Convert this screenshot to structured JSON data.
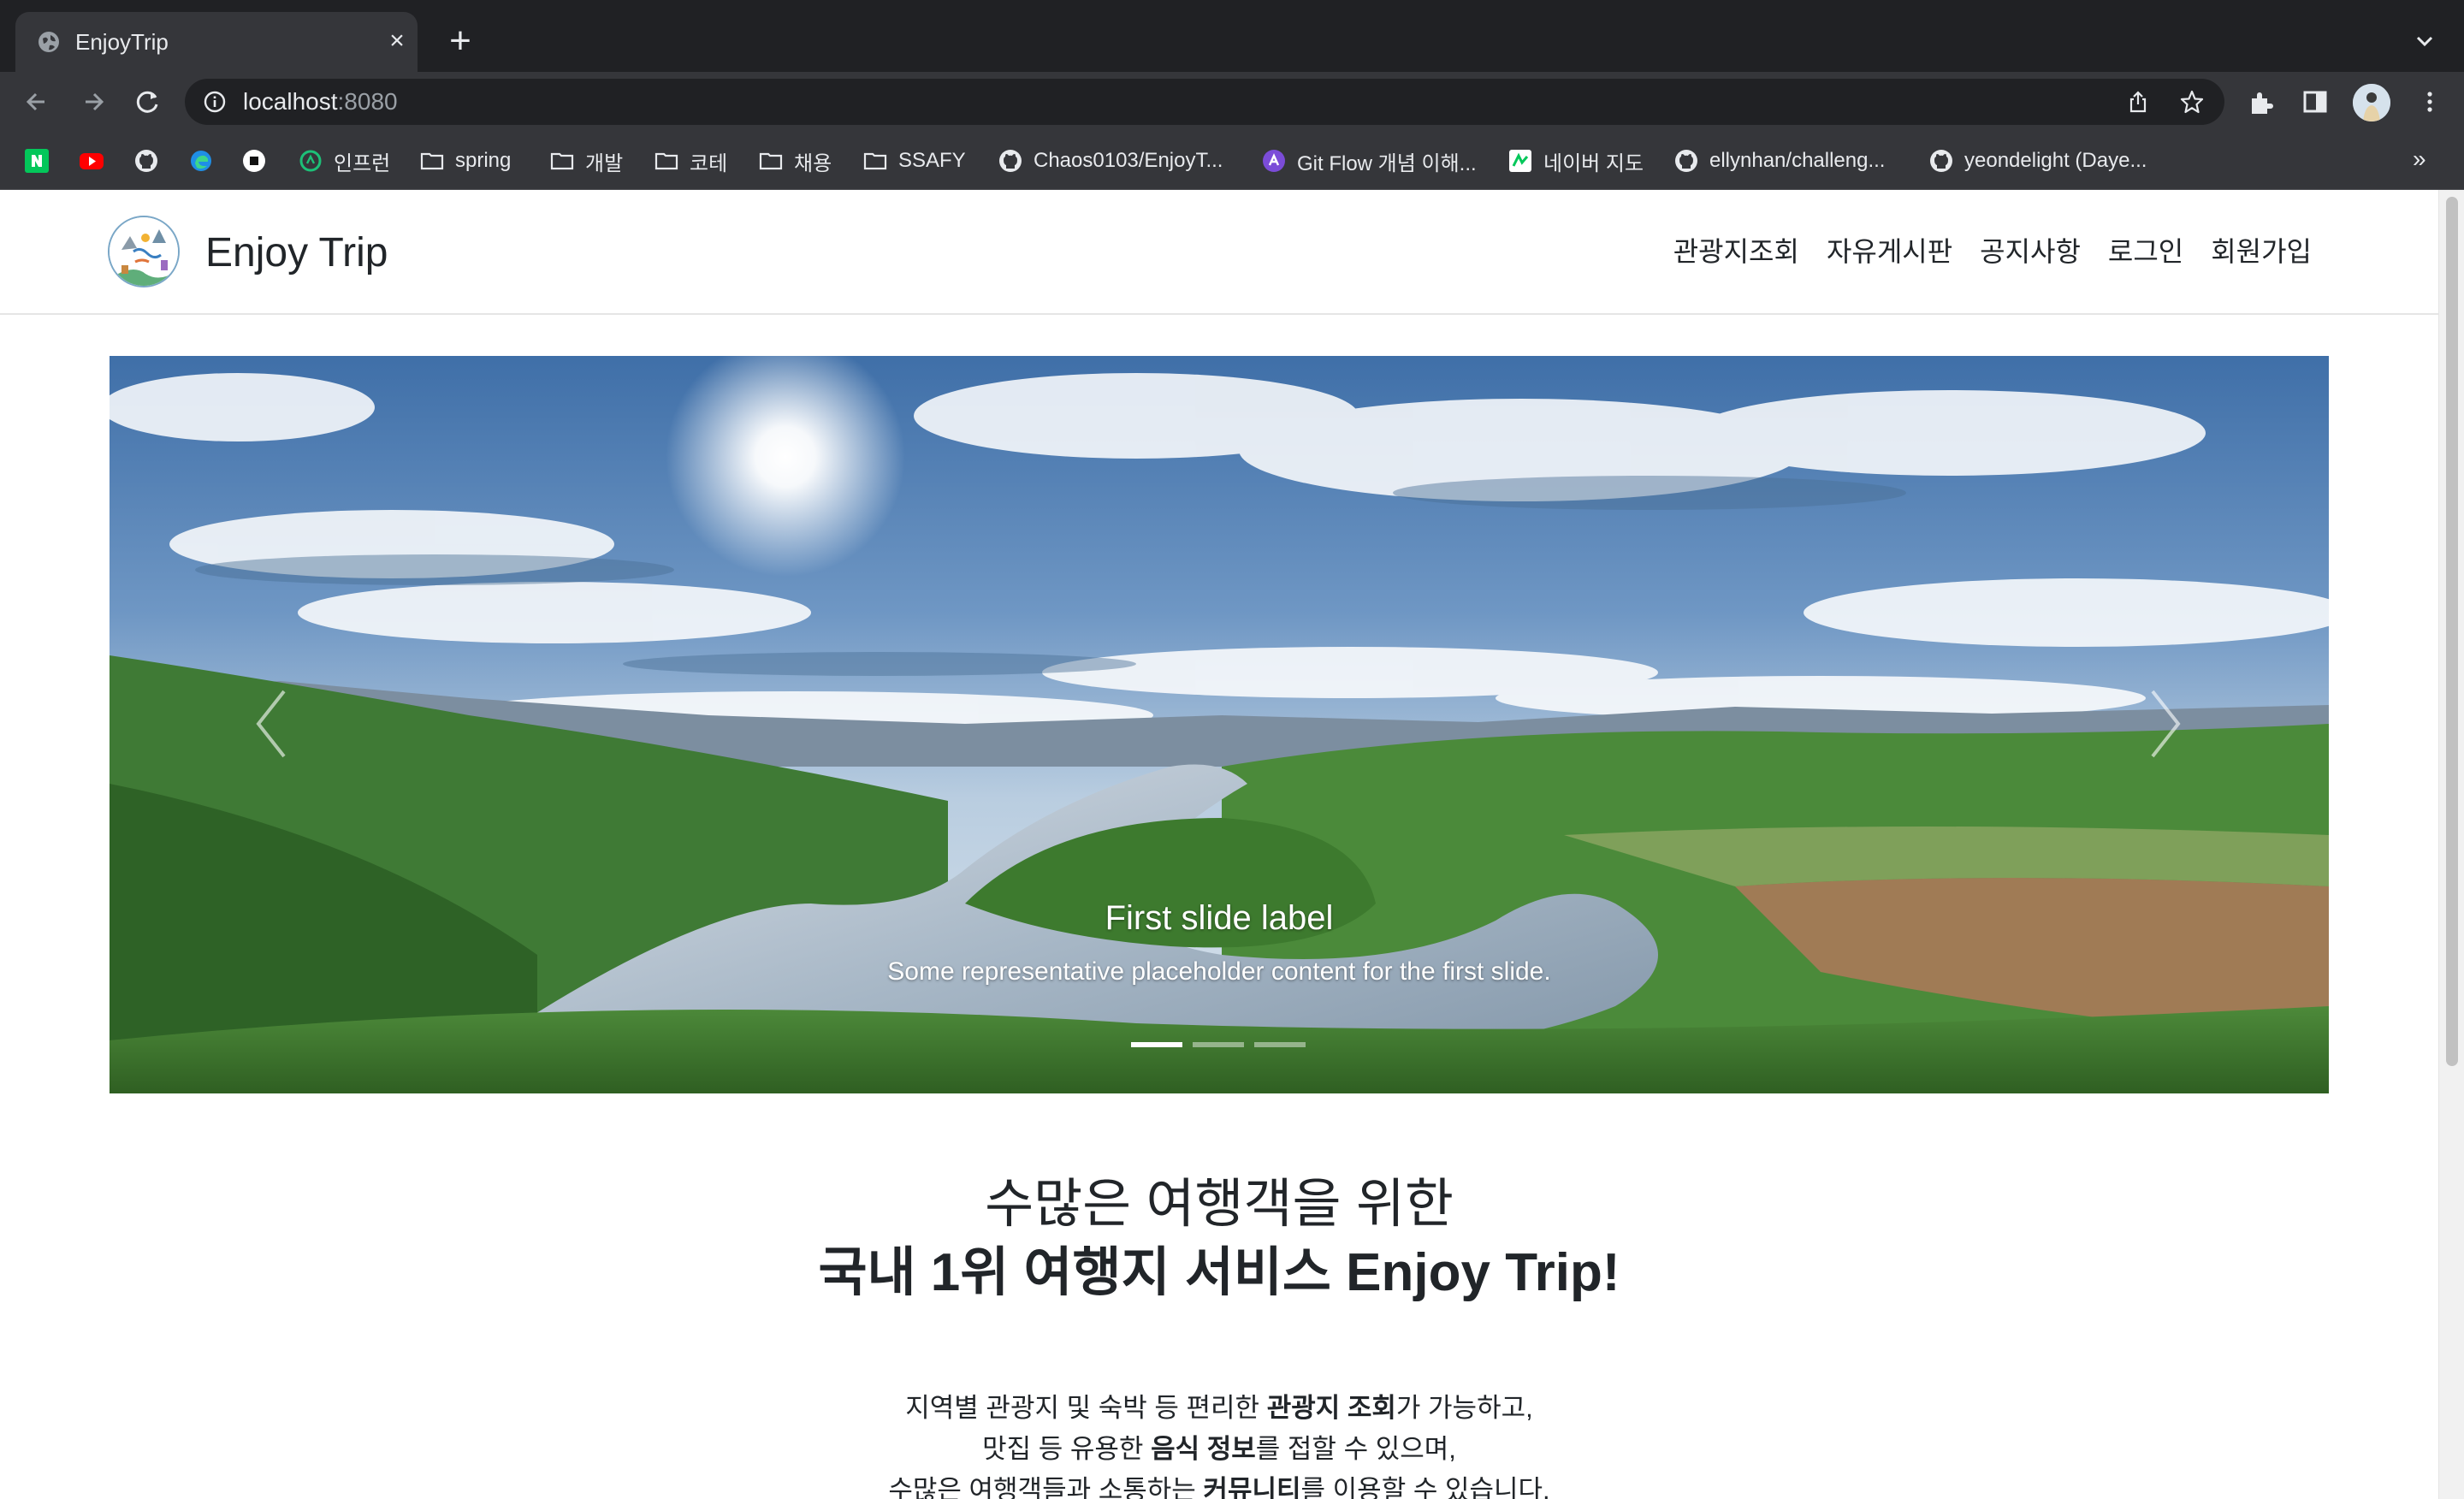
{
  "browser": {
    "tab_title": "EnjoyTrip",
    "url_host": "localhost",
    "url_port": ":8080",
    "bookmarks": [
      {
        "label": "",
        "icon": "naver-icon"
      },
      {
        "label": "",
        "icon": "youtube-icon"
      },
      {
        "label": "",
        "icon": "github-icon"
      },
      {
        "label": "",
        "icon": "edge-icon"
      },
      {
        "label": "",
        "icon": "app-icon"
      },
      {
        "label": "인프런",
        "icon": "inflearn-icon"
      },
      {
        "label": "spring",
        "icon": "folder-icon"
      },
      {
        "label": "개발",
        "icon": "folder-icon"
      },
      {
        "label": "코테",
        "icon": "folder-icon"
      },
      {
        "label": "채용",
        "icon": "folder-icon"
      },
      {
        "label": "SSAFY",
        "icon": "folder-icon"
      },
      {
        "label": "Chaos0103/EnjoyT...",
        "icon": "github-icon"
      },
      {
        "label": "Git Flow 개념 이해...",
        "icon": "gitflow-icon"
      },
      {
        "label": "네이버 지도",
        "icon": "naver-map-icon"
      },
      {
        "label": "ellynhan/challeng...",
        "icon": "github-icon"
      },
      {
        "label": "yeondelight (Daye...",
        "icon": "github-icon"
      }
    ],
    "more": "»"
  },
  "site": {
    "brand": "Enjoy Trip",
    "nav": [
      "관광지조회",
      "자유게시판",
      "공지사항",
      "로그인",
      "회원가입"
    ]
  },
  "carousel": {
    "caption_title": "First slide label",
    "caption_text": "Some representative placeholder content for the first slide.",
    "slide_count": 3,
    "active_index": 0
  },
  "intro": {
    "line1": "수많은 여행객을 위한",
    "line2": "국내 1위 여행지 서비스 Enjoy Trip!",
    "p1_a": "지역별 관광지 및 숙박 등 편리한 ",
    "p1_b": "관광지 조회",
    "p1_c": "가 가능하고,",
    "p2_a": "맛집 등 유용한 ",
    "p2_b": "음식 정보",
    "p2_c": "를 접할 수 있으며,",
    "p3_a": "수많은 여행객들과 소통하는 ",
    "p3_b": "커뮤니티",
    "p3_c": "를 이용할 수 있습니다."
  },
  "colors": {
    "chrome_dark": "#202124",
    "chrome_toolbar": "#35363a",
    "text": "#212529"
  }
}
